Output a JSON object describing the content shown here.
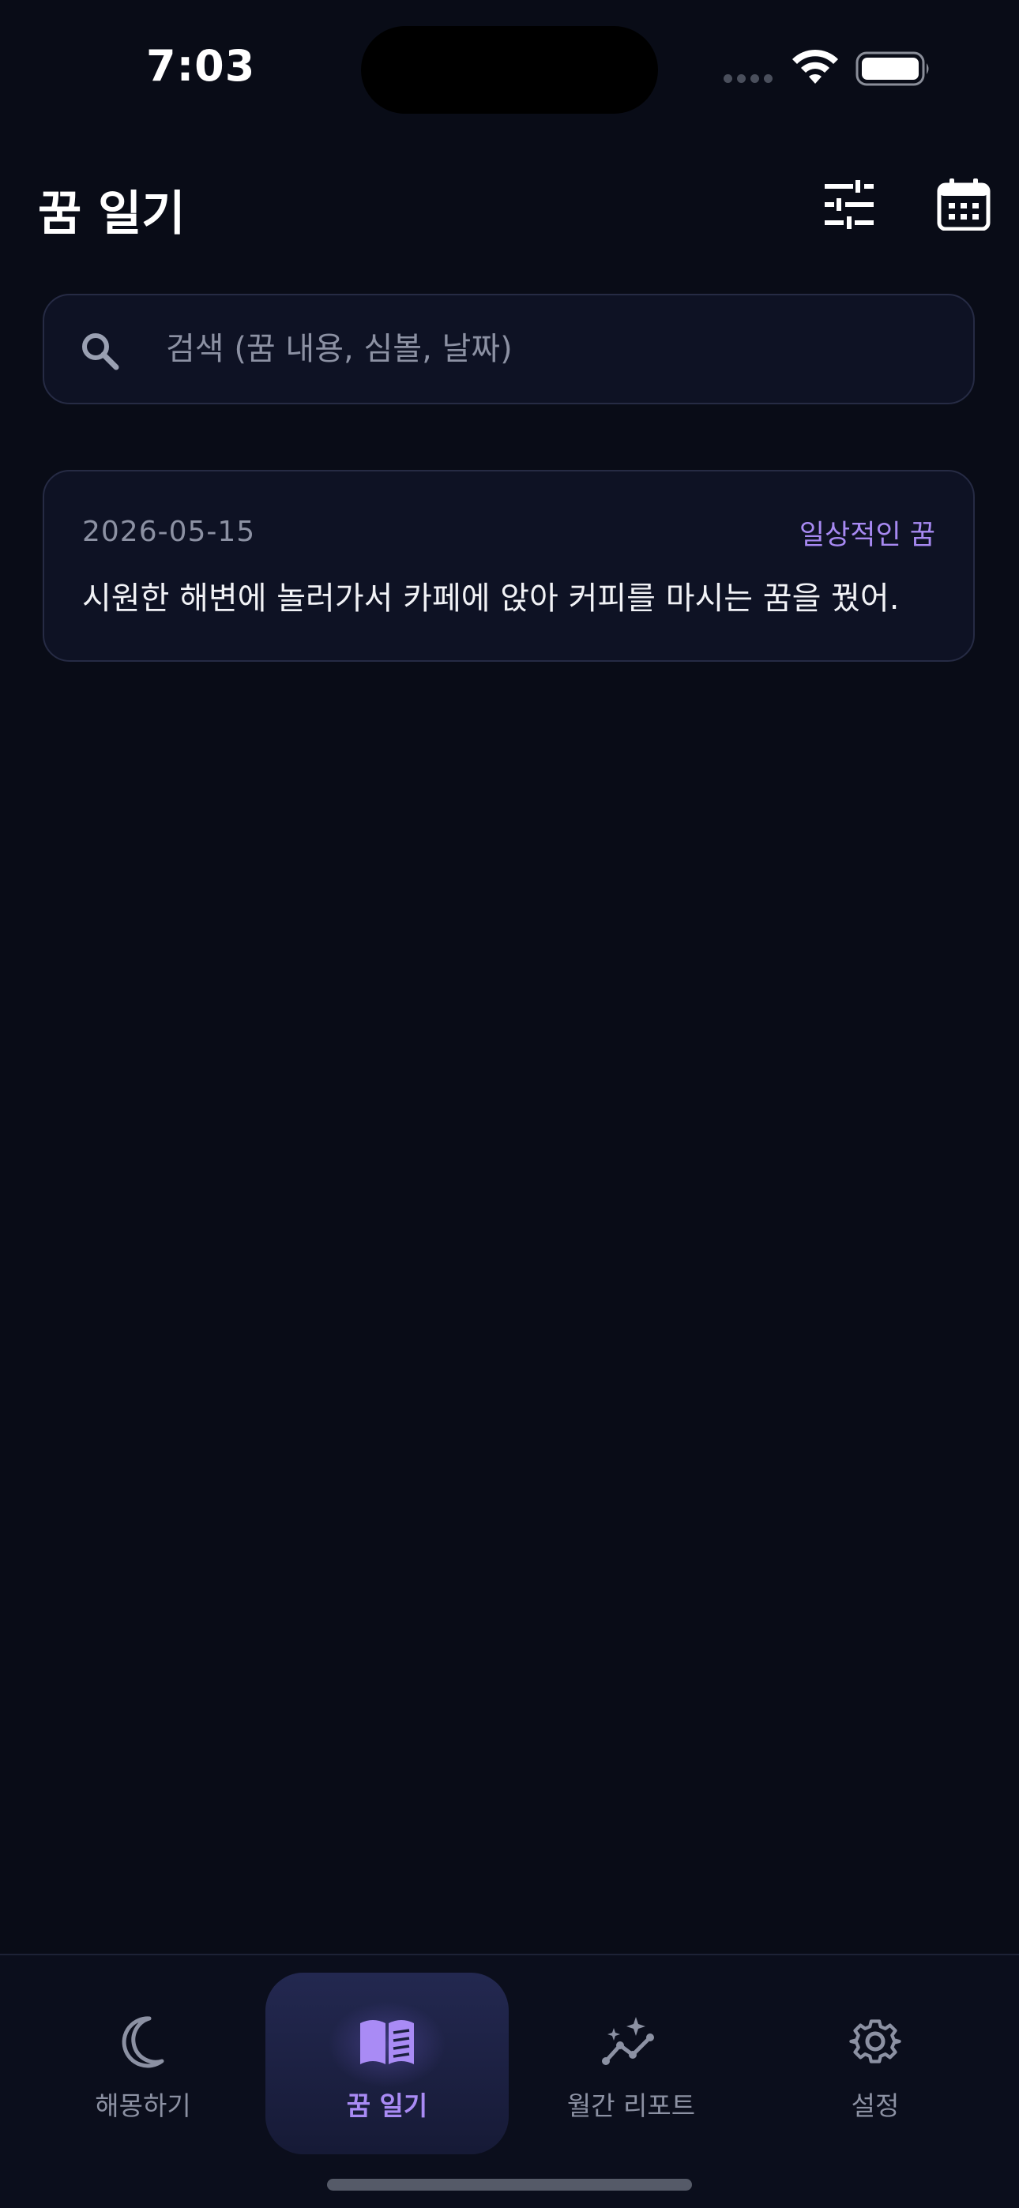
{
  "status_bar": {
    "time": "7:03"
  },
  "header": {
    "title": "꿈 일기",
    "filter_icon": "sliders-icon",
    "calendar_icon": "calendar-icon"
  },
  "search": {
    "placeholder": "검색 (꿈 내용, 심볼, 날짜)",
    "value": "",
    "icon": "search-icon"
  },
  "dreams": [
    {
      "date": "2026-05-15",
      "tag": "일상적인 꿈",
      "text": "시원한 해변에 놀러가서 카페에 앉아 커피를 마시는 꿈을 꿨어."
    }
  ],
  "tab_bar": {
    "tabs": [
      {
        "label": "해몽하기",
        "icon": "moon-icon",
        "active": false
      },
      {
        "label": "꿈 일기",
        "icon": "book-icon",
        "active": true
      },
      {
        "label": "월간 리포트",
        "icon": "trend-sparkle-icon",
        "active": false
      },
      {
        "label": "설정",
        "icon": "gear-icon",
        "active": false
      }
    ]
  },
  "colors": {
    "background": "#090c17",
    "card": "#0e1224",
    "border": "#262b44",
    "accent": "#a789f2",
    "muted_text": "#8c91a3"
  }
}
